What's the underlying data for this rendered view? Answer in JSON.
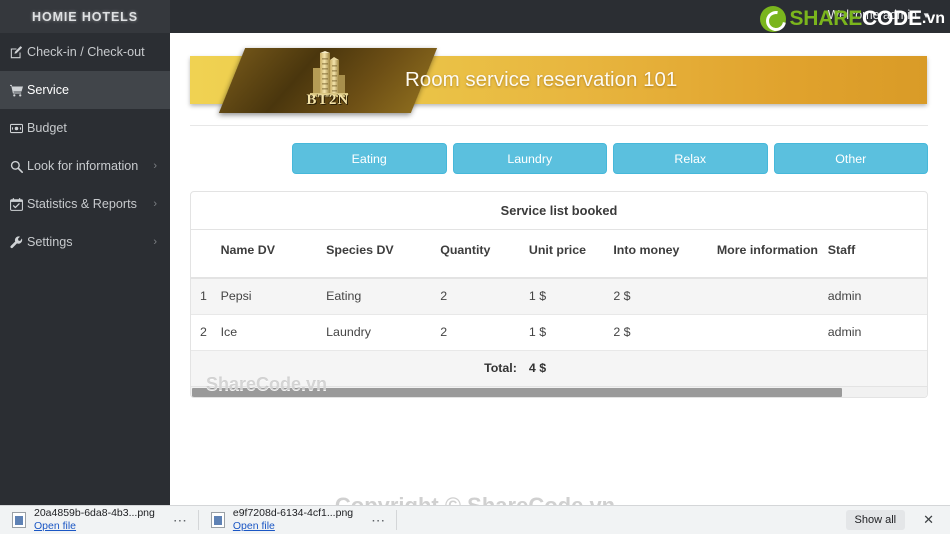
{
  "sidebar": {
    "brand": "HOMIE HOTELS",
    "items": [
      {
        "label": "Check-in / Check-out",
        "icon": "edit-square-icon",
        "active": false,
        "chevron": false
      },
      {
        "label": "Service",
        "icon": "shopping-cart-icon",
        "active": true,
        "chevron": false
      },
      {
        "label": "Budget",
        "icon": "money-bill-icon",
        "active": false,
        "chevron": false
      },
      {
        "label": "Look for information",
        "icon": "search-icon",
        "active": false,
        "chevron": true
      },
      {
        "label": "Statistics & Reports",
        "icon": "calendar-check-icon",
        "active": false,
        "chevron": true
      },
      {
        "label": "Settings",
        "icon": "wrench-icon",
        "active": false,
        "chevron": true
      }
    ]
  },
  "topbar": {
    "welcome": "Welcome admin",
    "caret_icon": "caret-down-icon"
  },
  "banner": {
    "logo_text": "BT2N",
    "logo_icon": "skyscraper-building-icon",
    "title": "Room service reservation 101",
    "gradient_from": "#f0d252",
    "gradient_to": "#d99b27"
  },
  "categories": {
    "accent_color": "#5bc0de",
    "buttons": [
      {
        "label": "Eating"
      },
      {
        "label": "Laundry"
      },
      {
        "label": "Relax"
      },
      {
        "label": "Other"
      }
    ]
  },
  "panel": {
    "heading": "Service list booked",
    "columns": [
      "",
      "Name DV",
      "Species DV",
      "Quantity",
      "Unit price",
      "Into money",
      "More information",
      "Staff"
    ],
    "rows": [
      {
        "idx": "1",
        "name": "Pepsi",
        "species": "Eating",
        "quantity": "2",
        "unit_price": "1 $",
        "into_money": "2 $",
        "more": "",
        "staff": "admin"
      },
      {
        "idx": "2",
        "name": "Ice",
        "species": "Laundry",
        "quantity": "2",
        "unit_price": "1 $",
        "into_money": "2 $",
        "more": "",
        "staff": "admin"
      }
    ],
    "total_label": "Total:",
    "total_value": "4 $"
  },
  "watermarks": {
    "table": "ShareCode.vn",
    "footer": "Copyright © ShareCode.vn",
    "logo_part1": "SHARE",
    "logo_part2": "CODE",
    "logo_part3": ".vn"
  },
  "downloads": {
    "items": [
      {
        "filename": "20a4859b-6da8-4b3...png",
        "action": "Open file",
        "menu": "⋯"
      },
      {
        "filename": "e9f7208d-6134-4cf1...png",
        "action": "Open file",
        "menu": "⋯"
      }
    ],
    "show_all": "Show all",
    "close_icon": "close-icon",
    "close_glyph": "✕"
  }
}
